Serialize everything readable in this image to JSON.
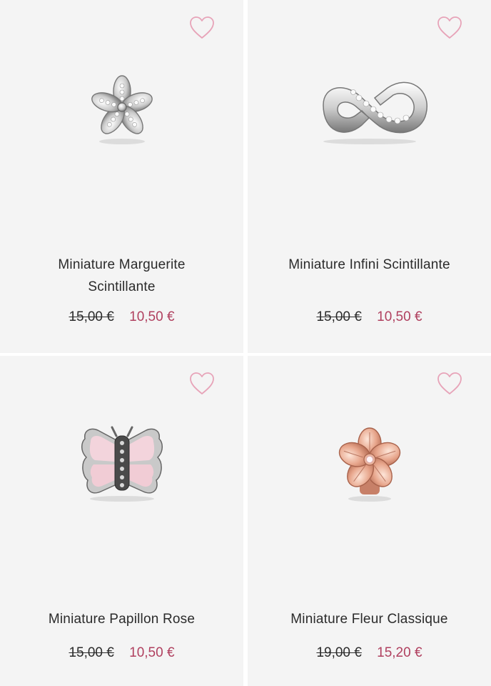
{
  "colors": {
    "card_background": "#f4f4f4",
    "sale_price": "#b0405f",
    "heart_outline": "#e7a3b8",
    "text": "#2b2b2b"
  },
  "products": [
    {
      "title": "Miniature Marguerite Scintillante",
      "old_price": "15,00 €",
      "price": "10,50 €",
      "icon": "heart-icon",
      "image": "daisy-charm"
    },
    {
      "title": "Miniature Infini Scintillante",
      "old_price": "15,00 €",
      "price": "10,50 €",
      "icon": "heart-icon",
      "image": "infinity-charm"
    },
    {
      "title": "Miniature Papillon Rose",
      "old_price": "15,00 €",
      "price": "10,50 €",
      "icon": "heart-icon",
      "image": "butterfly-charm"
    },
    {
      "title": "Miniature Fleur Classique",
      "old_price": "19,00 €",
      "price": "15,20 €",
      "icon": "heart-icon",
      "image": "flower-charm"
    }
  ]
}
